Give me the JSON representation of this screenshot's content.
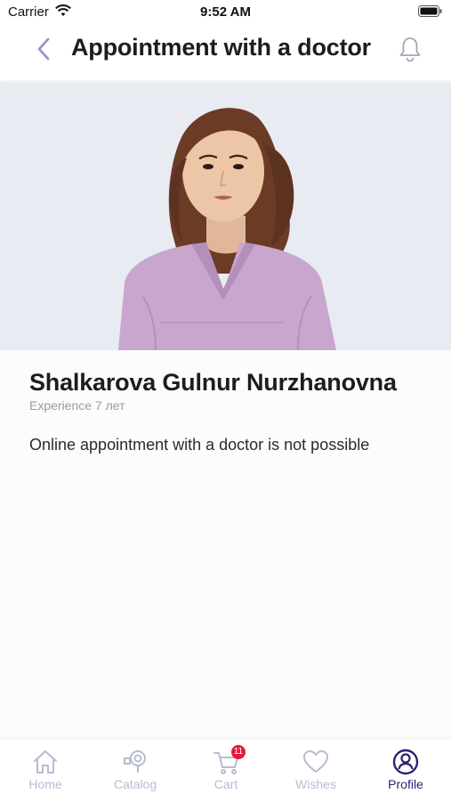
{
  "status_bar": {
    "carrier": "Carrier",
    "time": "9:52 AM"
  },
  "header": {
    "title": "Appointment with a doctor",
    "back_icon": "chevron-left-icon",
    "notification_icon": "bell-icon"
  },
  "doctor": {
    "name": "Shalkarova Gulnur Nurzhanovna",
    "experience": "Experience 7 лет",
    "appointment_note": "Online appointment with a doctor is not possible"
  },
  "tab_bar": {
    "items": [
      {
        "label": "Home",
        "icon": "home-icon",
        "active": false
      },
      {
        "label": "Catalog",
        "icon": "catalog-icon",
        "active": false
      },
      {
        "label": "Cart",
        "icon": "cart-icon",
        "active": false,
        "badge": "11"
      },
      {
        "label": "Wishes",
        "icon": "heart-icon",
        "active": false
      },
      {
        "label": "Profile",
        "icon": "profile-icon",
        "active": true
      }
    ]
  },
  "colors": {
    "accent": "#2a2370",
    "inactive_tab": "#b8bcd0",
    "badge": "#e8173d",
    "back_chevron": "#8f93c9",
    "photo_background": "#e8ebf1",
    "scrubs": "#c8a6cd"
  }
}
